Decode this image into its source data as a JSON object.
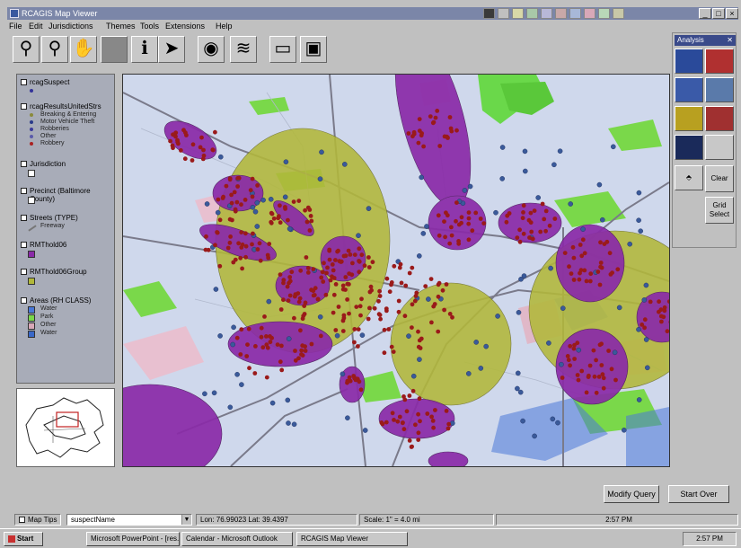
{
  "window": {
    "title": "RCAGIS Map Viewer"
  },
  "menu": [
    "File",
    "Edit",
    "Jurisdictions",
    "Themes",
    "Tools",
    "Extensions",
    "Help"
  ],
  "toolbar": [
    {
      "icon": "zoom-in-icon",
      "glyph": "🔍"
    },
    {
      "icon": "zoom-out-icon",
      "glyph": "🔍"
    },
    {
      "icon": "pan-hand-icon",
      "glyph": "✋"
    },
    {
      "icon": "measure-icon",
      "glyph": "▬"
    },
    {
      "icon": "identify-icon",
      "glyph": "ℹ"
    },
    {
      "icon": "pointer-icon",
      "glyph": "➤"
    },
    {
      "icon": "globe-icon",
      "glyph": "🌐"
    },
    {
      "icon": "layers-icon",
      "glyph": "≋"
    },
    {
      "icon": "page-icon",
      "glyph": "▭"
    },
    {
      "icon": "print-icon",
      "glyph": "▣"
    }
  ],
  "legend": {
    "layers": [
      {
        "name": "rcagSuspect",
        "entries": [
          {
            "label": "",
            "kind": "dot",
            "color": "#333399"
          }
        ]
      },
      {
        "name": "rcagResultsUnitedStrs",
        "entries": [
          {
            "label": "Breaking & Entering",
            "kind": "dot",
            "color": "#8a8a3a"
          },
          {
            "label": "Motor Vehicle Theft",
            "kind": "dot",
            "color": "#2a3a8a"
          },
          {
            "label": "Robberies",
            "kind": "dot",
            "color": "#3a3a9a"
          },
          {
            "label": "Other",
            "kind": "dot",
            "color": "#5a5aaa"
          },
          {
            "label": "Robbery",
            "kind": "dot",
            "color": "#aa2222"
          }
        ]
      },
      {
        "name": "Jurisdiction",
        "entries": [
          {
            "label": "",
            "kind": "box",
            "color": "#ffffff"
          }
        ]
      },
      {
        "name": "Precinct (Baltimore County)",
        "entries": [
          {
            "label": "",
            "kind": "box",
            "color": "#ffffff"
          }
        ]
      },
      {
        "name": "Streets (TYPE)",
        "entries": [
          {
            "label": "Freeway",
            "kind": "line",
            "color": "#777777"
          }
        ]
      },
      {
        "name": "RMThold06",
        "entries": [
          {
            "label": "",
            "kind": "box",
            "color": "#8a2aa8"
          }
        ]
      },
      {
        "name": "RMThold06Group",
        "entries": [
          {
            "label": "",
            "kind": "box",
            "color": "#b2b83a"
          }
        ]
      },
      {
        "name": "Areas (RH CLASS)",
        "entries": [
          {
            "label": "Water",
            "kind": "box",
            "color": "#4a78d8"
          },
          {
            "label": "Park",
            "kind": "box",
            "color": "#7ad84a"
          },
          {
            "label": "Other",
            "kind": "box",
            "color": "#d8a8b8"
          },
          {
            "label": "Water",
            "kind": "box",
            "color": "#3a68c8"
          }
        ]
      }
    ]
  },
  "map": {
    "background_color": "#cfd8ec",
    "cluster_color": "#8a2aa8",
    "zone_color": "#b2b83a",
    "incident_color": "#9a1a1a",
    "suspect_color": "#3a5a9a",
    "park_color": "#6ad84a",
    "water_color": "#4a78d8"
  },
  "panel": {
    "title": "Analysis",
    "close_glyph": "✕",
    "buttons": [
      {
        "label": "",
        "icon": "scatter-map-icon",
        "color": "#2a4a9a"
      },
      {
        "label": "",
        "icon": "hotspot-icon",
        "color": "#b03030"
      },
      {
        "label": "",
        "icon": "grid-map-icon",
        "color": "#3a5aa8"
      },
      {
        "label": "",
        "icon": "chart-icon",
        "color": "#5a7aaa"
      },
      {
        "label": "",
        "icon": "hotspot-label-icon",
        "color": "#b8a020"
      },
      {
        "label": "",
        "icon": "report-icon",
        "color": "#a03030"
      },
      {
        "label": "",
        "icon": "calendar-icon",
        "color": "#1a2a5a"
      },
      {
        "label": "",
        "icon": "settings-icon",
        "color": "#9a9a9a"
      }
    ],
    "clear_label": "Clear",
    "grid_select_label": "Grid Select"
  },
  "actions": {
    "modify_query": "Modify Query",
    "start_over": "Start Over"
  },
  "status": {
    "map_tips": "Map Tips",
    "map_tips_value": "suspectName",
    "coordinates": "Lon: 76.99023 Lat: 39.4397",
    "scale": "Scale: 1\" = 4.0 mi",
    "time": "2:57 PM"
  },
  "taskbar": {
    "start": "Start",
    "tasks": [
      "Microsoft PowerPoint - [res...",
      "Calendar - Microsoft Outlook",
      "RCAGIS Map Viewer"
    ],
    "clock": "2:57 PM"
  }
}
